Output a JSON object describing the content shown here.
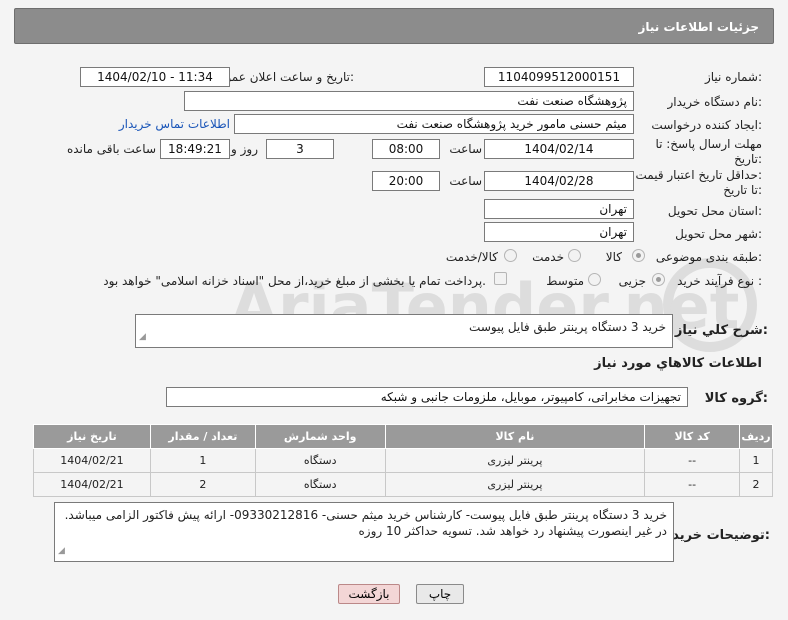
{
  "header": {
    "title": "جزئیات اطلاعات نیاز"
  },
  "fields": {
    "need_number_label": "شماره نیاز:",
    "need_number": "1104099512000151",
    "announce_label": "تاریخ و ساعت اعلان عمومی:",
    "announce_value": "1404/02/10 - 11:34",
    "buyer_org_label": "نام دستگاه خریدار:",
    "buyer_org": "پژوهشگاه صنعت نفت",
    "creator_label": "ایجاد کننده درخواست:",
    "creator": "میثم حسنی مامور خرید پژوهشگاه صنعت نفت",
    "contact_link": "اطلاعات تماس خریدار",
    "reply_deadline_label_1": "مهلت ارسال پاسخ: تا",
    "reply_deadline_label_2": "تاریخ:",
    "reply_date": "1404/02/14",
    "time_label": "ساعت",
    "reply_time": "08:00",
    "days": "3",
    "days_label": "روز و",
    "remaining_time": "18:49:21",
    "remaining_label": "ساعت باقی مانده",
    "price_deadline_label_1": "حداقل تاریخ اعتبار قیمت:",
    "price_deadline_label_2": "تا تاریخ:",
    "price_date": "1404/02/28",
    "price_time": "20:00",
    "province_label": "استان محل تحویل:",
    "province": "تهران",
    "city_label": "شهر محل تحویل:",
    "city": "تهران",
    "category_label": "طبقه بندی موضوعی:",
    "category_options": [
      "کالا",
      "خدمت",
      "کالا/خدمت"
    ],
    "process_label": "نوع فرآیند خرید :",
    "process_options": [
      "جزیی",
      "متوسط"
    ],
    "payment_note": "پرداخت تمام یا بخشی از مبلغ خرید،از محل \"اسناد خزانه اسلامی\" خواهد بود.",
    "summary_label": "شرح کلي نياز:",
    "summary": "خرید 3 دستگاه پرینتر طبق فایل پیوست",
    "goods_info_title": "اطلاعات كالاهاي مورد نياز",
    "goods_group_label": "گروه کالا:",
    "goods_group": "تجهیزات مخابراتی، کامپیوتر، موبایل، ملزومات جانبی و شبکه",
    "buyer_notes_label": "توضیحات خریدار:",
    "buyer_notes": "خرید 3 دستگاه پرینتر طبق فایل پیوست- کارشناس خرید میثم حسنی- 09330212816- ارائه پیش فاکتور الزامی میباشد. در غیر اینصورت پیشنهاد رد خواهد شد. تسویه حداکثر 10 روزه"
  },
  "table": {
    "headers": [
      "ردیف",
      "کد کالا",
      "نام کالا",
      "واحد شمارش",
      "تعداد / مقدار",
      "تاریخ نیاز"
    ],
    "rows": [
      [
        "1",
        "--",
        "پرینتر لیزری",
        "دستگاه",
        "1",
        "1404/02/21"
      ],
      [
        "2",
        "--",
        "پرینتر لیزری",
        "دستگاه",
        "2",
        "1404/02/21"
      ]
    ]
  },
  "buttons": {
    "print": "چاپ",
    "back": "بازگشت"
  },
  "watermark": {
    "text": "AriaTender.net"
  },
  "colors": {
    "header_bg": "#8c8c8c",
    "link": "#1a55b8",
    "table_head": "#9a9a9a"
  }
}
